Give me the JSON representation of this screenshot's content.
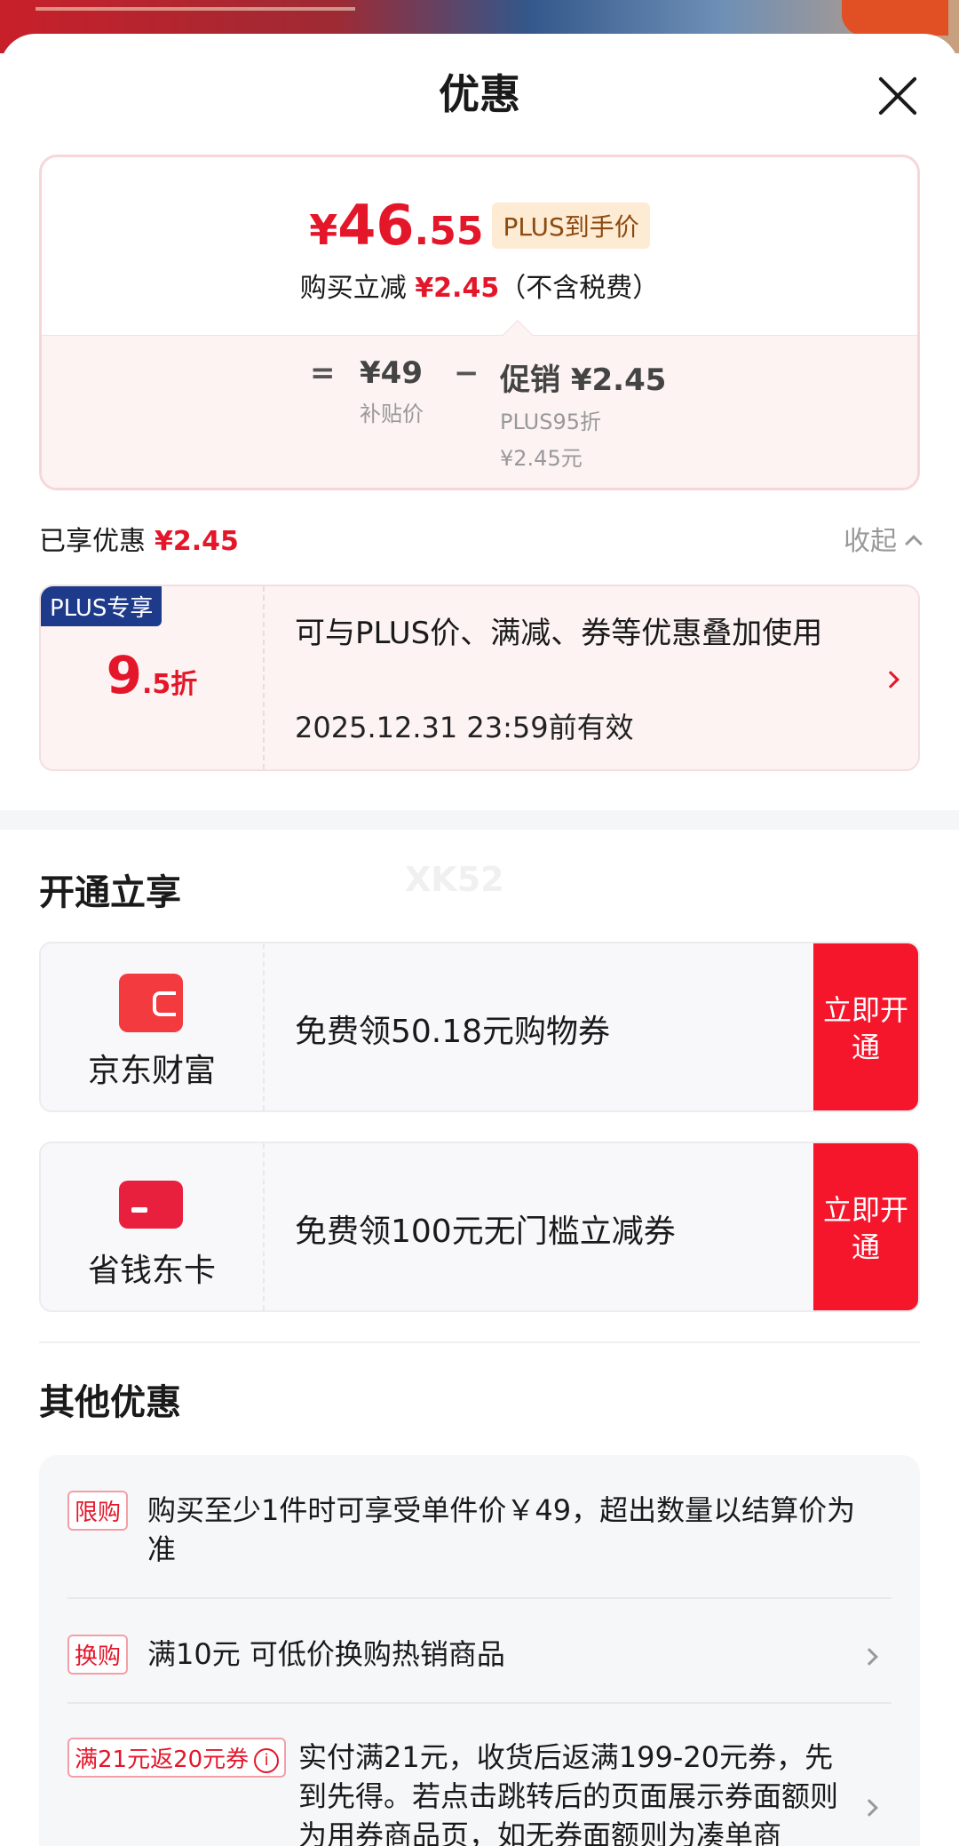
{
  "sheet": {
    "title": "优惠"
  },
  "price_card": {
    "currency": "¥",
    "price_int": "46",
    "price_dec": ".55",
    "plus_tag": "PLUS到手价",
    "sub_prefix": "购买立减",
    "sub_amount": "¥2.45",
    "sub_suffix": "（不含税费）",
    "equals": "=",
    "base_value": "¥49",
    "base_label": "补贴价",
    "minus": "−",
    "promo_value": "促销 ¥2.45",
    "promo_label1": "PLUS95折",
    "promo_label2": "¥2.45元"
  },
  "enjoyed": {
    "label": "已享优惠",
    "amount": "¥2.45",
    "collapse_label": "收起"
  },
  "plus_coupon": {
    "badge": "PLUS专享",
    "discount_big": "9",
    "discount_small": ".5折",
    "description": "可与PLUS价、满减、券等优惠叠加使用",
    "validity": "2025.12.31 23:59前有效"
  },
  "open_section": {
    "title": "开通立享",
    "watermark": "XK52",
    "offers": [
      {
        "name": "京东财富",
        "text": "免费领50.18元购物券",
        "button": "立即开通"
      },
      {
        "name": "省钱东卡",
        "text": "免费领100元无门槛立减券",
        "button": "立即开通"
      }
    ]
  },
  "other_section": {
    "title": "其他优惠",
    "items": [
      {
        "tag": "限购",
        "text": "购买至少1件时可享受单件价￥49，超出数量以结算价为准"
      },
      {
        "tag": "换购",
        "text": "满10元 可低价换购热销商品"
      },
      {
        "tag": "满21元返20元券",
        "info": "i",
        "text": "实付满21元，收货后返满199-20元券，先到先得。若点击跳转后的页面展示券面额则为用券商品页，如无券面额则为凑单商"
      }
    ]
  },
  "colors": {
    "accent": "#e4162a",
    "plus_blue": "#1e3a8a",
    "button_red": "#f5162c"
  }
}
